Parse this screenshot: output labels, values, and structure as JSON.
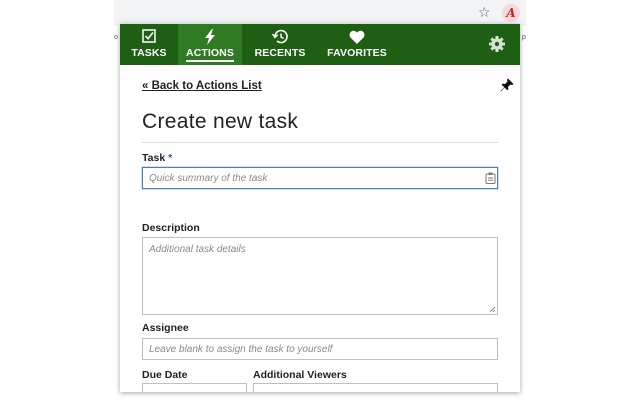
{
  "browser": {
    "star_icon": "☆",
    "extension_letter": "A"
  },
  "nav": {
    "tabs": [
      {
        "label": "TASKS",
        "icon": "checkbox-icon"
      },
      {
        "label": "ACTIONS",
        "icon": "lightning-icon",
        "active": true
      },
      {
        "label": "RECENTS",
        "icon": "history-icon"
      },
      {
        "label": "FAVORITES",
        "icon": "heart-icon"
      }
    ],
    "settings_icon": "gear-icon"
  },
  "back_link": "« Back to Actions List",
  "pin_icon": "pushpin-icon",
  "title": "Create new task",
  "form": {
    "task_label": "Task",
    "required_mark": "*",
    "task_placeholder": "Quick summary of the task",
    "description_label": "Description",
    "description_placeholder": "Additional task details",
    "assignee_label": "Assignee",
    "assignee_placeholder": "Leave blank to assign the task to yourself",
    "due_date_label": "Due Date",
    "viewers_label": "Additional Viewers"
  },
  "colors": {
    "nav_bg": "#1e5f14",
    "nav_active": "#2f7a22",
    "focus_border": "#4a7ec2",
    "required": "#2a5db0"
  }
}
